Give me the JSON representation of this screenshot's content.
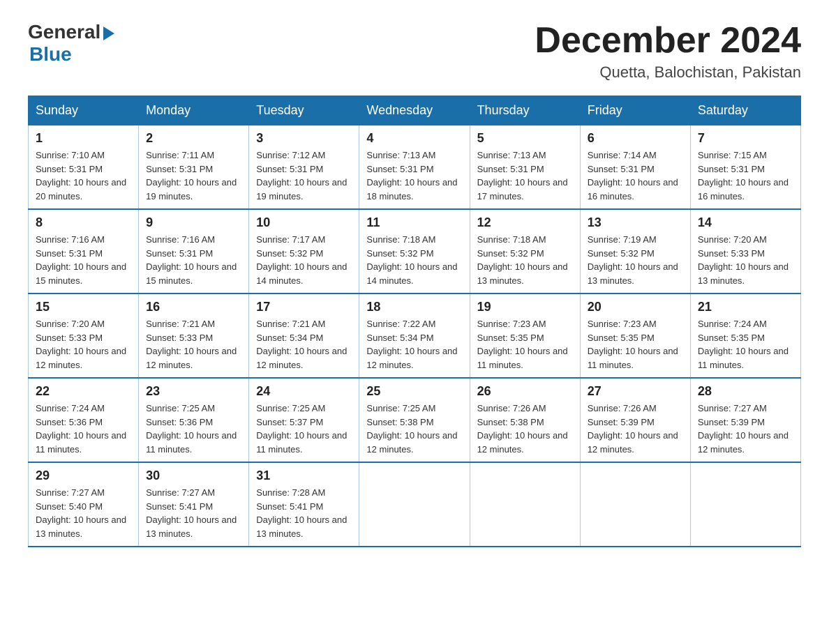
{
  "logo": {
    "general": "General",
    "blue": "Blue"
  },
  "header": {
    "month_year": "December 2024",
    "location": "Quetta, Balochistan, Pakistan"
  },
  "days_of_week": [
    "Sunday",
    "Monday",
    "Tuesday",
    "Wednesday",
    "Thursday",
    "Friday",
    "Saturday"
  ],
  "weeks": [
    [
      {
        "day": "1",
        "sunrise": "7:10 AM",
        "sunset": "5:31 PM",
        "daylight": "10 hours and 20 minutes."
      },
      {
        "day": "2",
        "sunrise": "7:11 AM",
        "sunset": "5:31 PM",
        "daylight": "10 hours and 19 minutes."
      },
      {
        "day": "3",
        "sunrise": "7:12 AM",
        "sunset": "5:31 PM",
        "daylight": "10 hours and 19 minutes."
      },
      {
        "day": "4",
        "sunrise": "7:13 AM",
        "sunset": "5:31 PM",
        "daylight": "10 hours and 18 minutes."
      },
      {
        "day": "5",
        "sunrise": "7:13 AM",
        "sunset": "5:31 PM",
        "daylight": "10 hours and 17 minutes."
      },
      {
        "day": "6",
        "sunrise": "7:14 AM",
        "sunset": "5:31 PM",
        "daylight": "10 hours and 16 minutes."
      },
      {
        "day": "7",
        "sunrise": "7:15 AM",
        "sunset": "5:31 PM",
        "daylight": "10 hours and 16 minutes."
      }
    ],
    [
      {
        "day": "8",
        "sunrise": "7:16 AM",
        "sunset": "5:31 PM",
        "daylight": "10 hours and 15 minutes."
      },
      {
        "day": "9",
        "sunrise": "7:16 AM",
        "sunset": "5:31 PM",
        "daylight": "10 hours and 15 minutes."
      },
      {
        "day": "10",
        "sunrise": "7:17 AM",
        "sunset": "5:32 PM",
        "daylight": "10 hours and 14 minutes."
      },
      {
        "day": "11",
        "sunrise": "7:18 AM",
        "sunset": "5:32 PM",
        "daylight": "10 hours and 14 minutes."
      },
      {
        "day": "12",
        "sunrise": "7:18 AM",
        "sunset": "5:32 PM",
        "daylight": "10 hours and 13 minutes."
      },
      {
        "day": "13",
        "sunrise": "7:19 AM",
        "sunset": "5:32 PM",
        "daylight": "10 hours and 13 minutes."
      },
      {
        "day": "14",
        "sunrise": "7:20 AM",
        "sunset": "5:33 PM",
        "daylight": "10 hours and 13 minutes."
      }
    ],
    [
      {
        "day": "15",
        "sunrise": "7:20 AM",
        "sunset": "5:33 PM",
        "daylight": "10 hours and 12 minutes."
      },
      {
        "day": "16",
        "sunrise": "7:21 AM",
        "sunset": "5:33 PM",
        "daylight": "10 hours and 12 minutes."
      },
      {
        "day": "17",
        "sunrise": "7:21 AM",
        "sunset": "5:34 PM",
        "daylight": "10 hours and 12 minutes."
      },
      {
        "day": "18",
        "sunrise": "7:22 AM",
        "sunset": "5:34 PM",
        "daylight": "10 hours and 12 minutes."
      },
      {
        "day": "19",
        "sunrise": "7:23 AM",
        "sunset": "5:35 PM",
        "daylight": "10 hours and 11 minutes."
      },
      {
        "day": "20",
        "sunrise": "7:23 AM",
        "sunset": "5:35 PM",
        "daylight": "10 hours and 11 minutes."
      },
      {
        "day": "21",
        "sunrise": "7:24 AM",
        "sunset": "5:35 PM",
        "daylight": "10 hours and 11 minutes."
      }
    ],
    [
      {
        "day": "22",
        "sunrise": "7:24 AM",
        "sunset": "5:36 PM",
        "daylight": "10 hours and 11 minutes."
      },
      {
        "day": "23",
        "sunrise": "7:25 AM",
        "sunset": "5:36 PM",
        "daylight": "10 hours and 11 minutes."
      },
      {
        "day": "24",
        "sunrise": "7:25 AM",
        "sunset": "5:37 PM",
        "daylight": "10 hours and 11 minutes."
      },
      {
        "day": "25",
        "sunrise": "7:25 AM",
        "sunset": "5:38 PM",
        "daylight": "10 hours and 12 minutes."
      },
      {
        "day": "26",
        "sunrise": "7:26 AM",
        "sunset": "5:38 PM",
        "daylight": "10 hours and 12 minutes."
      },
      {
        "day": "27",
        "sunrise": "7:26 AM",
        "sunset": "5:39 PM",
        "daylight": "10 hours and 12 minutes."
      },
      {
        "day": "28",
        "sunrise": "7:27 AM",
        "sunset": "5:39 PM",
        "daylight": "10 hours and 12 minutes."
      }
    ],
    [
      {
        "day": "29",
        "sunrise": "7:27 AM",
        "sunset": "5:40 PM",
        "daylight": "10 hours and 13 minutes."
      },
      {
        "day": "30",
        "sunrise": "7:27 AM",
        "sunset": "5:41 PM",
        "daylight": "10 hours and 13 minutes."
      },
      {
        "day": "31",
        "sunrise": "7:28 AM",
        "sunset": "5:41 PM",
        "daylight": "10 hours and 13 minutes."
      },
      null,
      null,
      null,
      null
    ]
  ],
  "labels": {
    "sunrise": "Sunrise:",
    "sunset": "Sunset:",
    "daylight": "Daylight:"
  }
}
